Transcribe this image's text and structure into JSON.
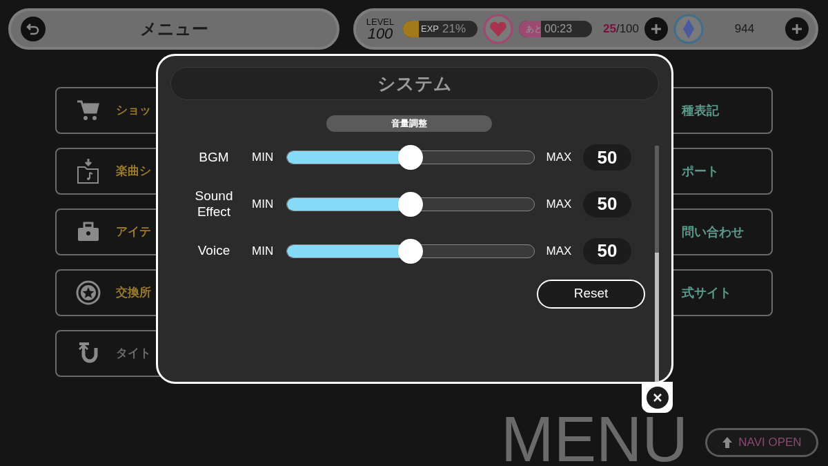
{
  "header": {
    "title": "メニュー",
    "level_label": "LEVEL",
    "level": "100",
    "exp": {
      "label": "EXP",
      "value": "21%",
      "level": 0.21
    },
    "stamina": {
      "prefix": "あと",
      "timer": "00:23",
      "level": 0.3,
      "current": "25",
      "max": "/100"
    },
    "crystals": "944"
  },
  "menu_left": [
    {
      "label": "ショッ",
      "kind": "primary"
    },
    {
      "label": "楽曲シ",
      "kind": "primary"
    },
    {
      "label": "アイテ",
      "kind": "primary"
    },
    {
      "label": "交換所",
      "kind": "primary"
    },
    {
      "label": "タイト",
      "kind": "secondary"
    }
  ],
  "menu_right": [
    {
      "label": "種表記"
    },
    {
      "label": "ポート"
    },
    {
      "label": "問い合わせ"
    },
    {
      "label": "式サイト"
    }
  ],
  "dialog": {
    "title": "システム",
    "section": "音量調整",
    "channels": [
      {
        "name": "BGM",
        "min": "MIN",
        "max": "MAX",
        "level": 0.5,
        "value": "50"
      },
      {
        "name": "Sound Effect",
        "min": "MIN",
        "max": "MAX",
        "level": 0.5,
        "value": "50"
      },
      {
        "name": "Voice",
        "min": "MIN",
        "max": "MAX",
        "level": 0.5,
        "value": "50"
      }
    ],
    "reset": "Reset"
  },
  "backdrop_text": "MENU",
  "navi_button": "NAVI OPEN"
}
